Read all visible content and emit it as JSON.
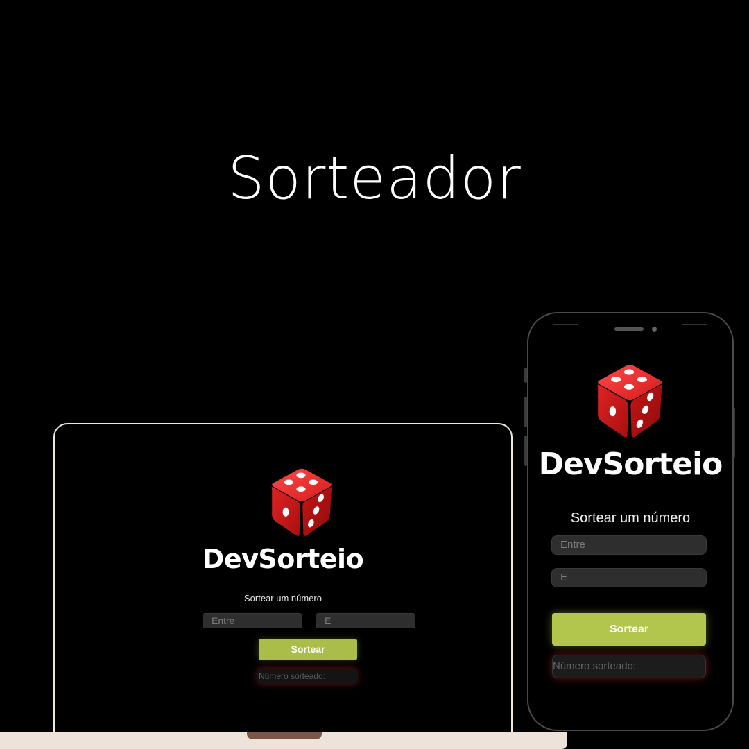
{
  "hero": {
    "title": "Sorteador"
  },
  "app": {
    "logo_text": "DevSorteio",
    "subtitle": "Sortear um número",
    "input_from_placeholder": "Entre",
    "input_to_placeholder": "E",
    "button_label": "Sortear",
    "result_placeholder": "Número sorteado:",
    "icon": "dice-icon"
  },
  "colors": {
    "background": "#000000",
    "button": "#aabd48",
    "dice": "#d81e1e",
    "result_glow": "#be2828"
  }
}
